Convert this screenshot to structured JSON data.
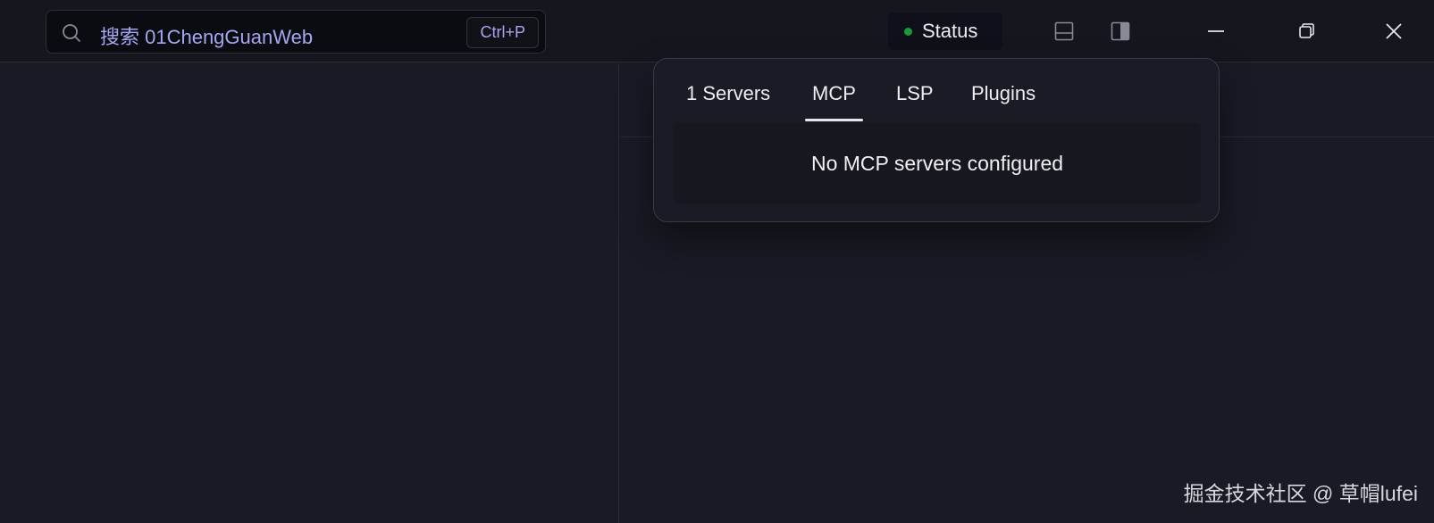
{
  "titlebar": {
    "search": {
      "icon": "search-icon",
      "text": "搜索 01ChengGuanWeb",
      "shortcut": "Ctrl+P"
    },
    "status": {
      "label": "Status",
      "dot_color": "#1c9a3a"
    },
    "icons": {
      "toggle_bottom_panel": "panel-bottom-icon",
      "toggle_side_panel": "panel-right-icon"
    },
    "window_controls": {
      "minimize": "minimize-icon",
      "restore": "restore-icon",
      "close": "close-icon"
    }
  },
  "status_popover": {
    "tabs": [
      {
        "label": "1 Servers",
        "active": false
      },
      {
        "label": "MCP",
        "active": true
      },
      {
        "label": "LSP",
        "active": false
      },
      {
        "label": "Plugins",
        "active": false
      }
    ],
    "empty_message": "No MCP servers configured"
  },
  "watermark": "掘金技术社区 @ 草帽lufei",
  "colors": {
    "background": "#1a1a25",
    "titlebar": "#16161f",
    "accent_text": "#a6a6f0"
  }
}
